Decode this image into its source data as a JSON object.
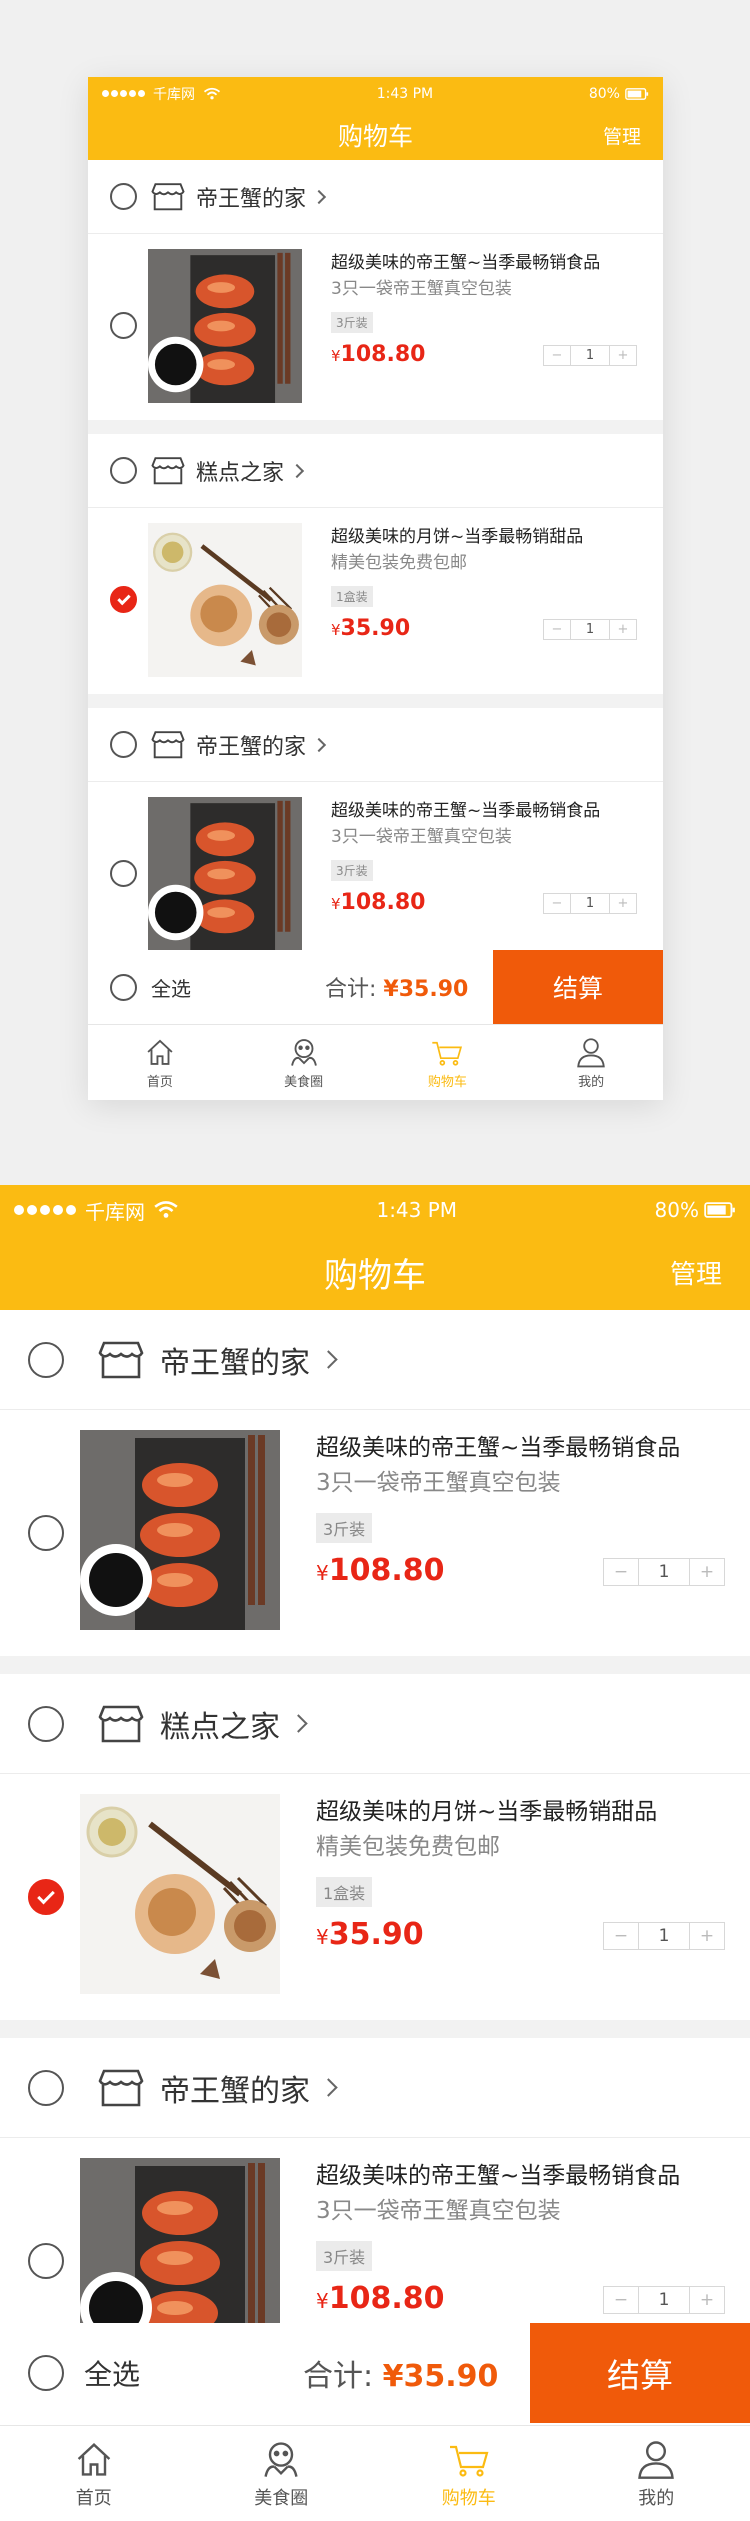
{
  "status": {
    "carrier": "千库网",
    "time": "1:43 PM",
    "battery": "80%"
  },
  "nav": {
    "title": "购物车",
    "manage": "管理"
  },
  "stores": [
    {
      "name": "帝王蟹的家",
      "checked": false,
      "item": {
        "title": "超级美味的帝王蟹~当季最畅销食品",
        "subtitle": "3只一袋帝王蟹真空包装",
        "spec": "3斤装",
        "currency": "¥",
        "price": "108.80",
        "qty": "1",
        "minus": "−",
        "plus": "+",
        "image": "crab",
        "checked": false
      }
    },
    {
      "name": "糕点之家",
      "checked": false,
      "item": {
        "title": "超级美味的月饼~当季最畅销甜品",
        "subtitle": "精美包装免费包邮",
        "spec": "1盒装",
        "currency": "¥",
        "price": "35.90",
        "qty": "1",
        "minus": "−",
        "plus": "+",
        "image": "mooncake",
        "checked": true
      }
    },
    {
      "name": "帝王蟹的家",
      "checked": false,
      "item": {
        "title": "超级美味的帝王蟹~当季最畅销食品",
        "subtitle": "3只一袋帝王蟹真空包装",
        "spec": "3斤装",
        "currency": "¥",
        "price": "108.80",
        "qty": "1",
        "minus": "−",
        "plus": "+",
        "image": "crab",
        "checked": false
      }
    }
  ],
  "footer": {
    "select_all": "全选",
    "total_label": "合计:",
    "total_currency": "¥",
    "total_value": "35.90",
    "checkout": "结算"
  },
  "tabs": [
    {
      "label": "首页",
      "icon": "home-icon",
      "active": false
    },
    {
      "label": "美食圈",
      "icon": "food-circle-icon",
      "active": false
    },
    {
      "label": "购物车",
      "icon": "cart-icon",
      "active": true
    },
    {
      "label": "我的",
      "icon": "profile-icon",
      "active": false
    }
  ],
  "colors": {
    "brand_yellow": "#fbbb12",
    "checkout_orange": "#f05a0a",
    "price_red": "#e82616"
  }
}
